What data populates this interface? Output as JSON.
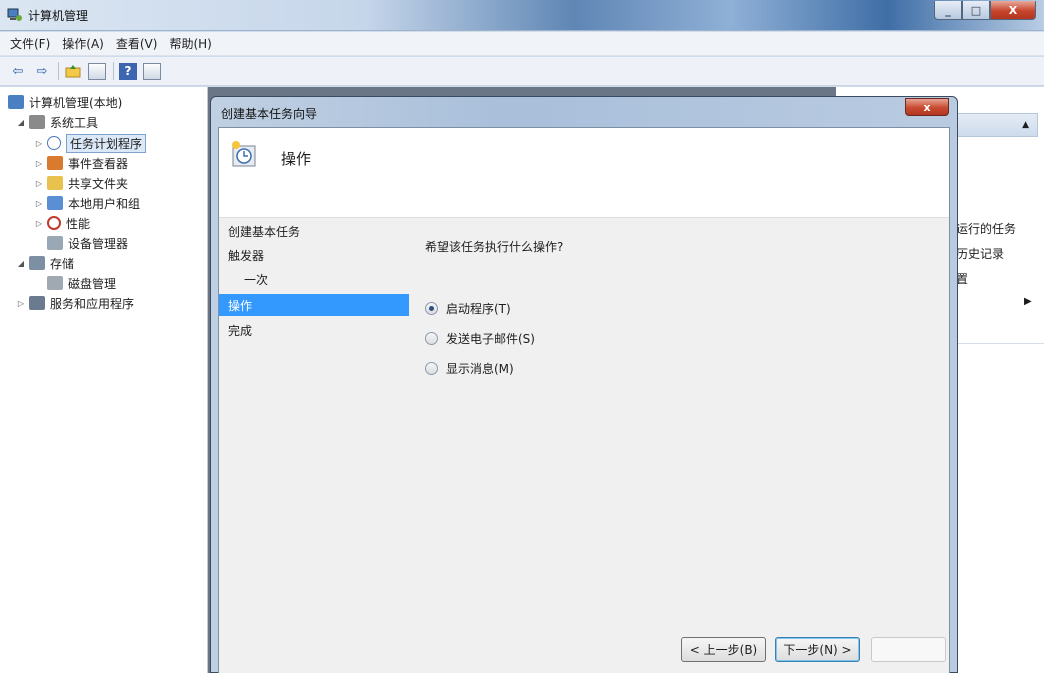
{
  "window": {
    "title": "计算机管理",
    "icon": "computer-management-icon",
    "buttons": {
      "minimize": "_",
      "maximize": "□",
      "close": "X"
    }
  },
  "menu": [
    "文件(F)",
    "操作(A)",
    "查看(V)",
    "帮助(H)"
  ],
  "toolbar": {
    "buttons": [
      "back-arrow-icon",
      "forward-arrow-icon",
      "up-folder-icon",
      "show-hide-tree-icon",
      "help-icon",
      "show-hide-action-pane-icon"
    ],
    "back": "⇦",
    "forward": "⇨",
    "help": "?"
  },
  "tree": {
    "items": [
      {
        "label": "计算机管理(本地)",
        "arrow": "",
        "icon": "computer-icon"
      },
      {
        "label": "系统工具",
        "arrow": "◢",
        "icon": "tools-icon"
      },
      {
        "label": "任务计划程序",
        "arrow": "▷",
        "icon": "clock-icon",
        "selected": true
      },
      {
        "label": "事件查看器",
        "arrow": "▷",
        "icon": "event-viewer-icon"
      },
      {
        "label": "共享文件夹",
        "arrow": "▷",
        "icon": "shared-folder-icon"
      },
      {
        "label": "本地用户和组",
        "arrow": "▷",
        "icon": "users-icon"
      },
      {
        "label": "性能",
        "arrow": "▷",
        "icon": "performance-icon"
      },
      {
        "label": "设备管理器",
        "arrow": "",
        "icon": "device-manager-icon"
      },
      {
        "label": "存储",
        "arrow": "◢",
        "icon": "storage-icon"
      },
      {
        "label": "磁盘管理",
        "arrow": "",
        "icon": "disk-icon"
      },
      {
        "label": "服务和应用程序",
        "arrow": "▷",
        "icon": "services-icon"
      }
    ]
  },
  "actions": {
    "collapse_arrow": "▲",
    "items": [
      "运行的任务",
      "历史记录",
      "置"
    ],
    "submenu_arrow": "▶"
  },
  "dialog": {
    "title": "创建基本任务向导",
    "close": "x",
    "header_title": "操作",
    "header_icon": "scheduled-task-icon",
    "steps": [
      {
        "label": "创建基本任务"
      },
      {
        "label": "触发器"
      },
      {
        "label": "一次",
        "indent": true
      },
      {
        "label": "操作",
        "active": true
      },
      {
        "label": "完成"
      }
    ],
    "prompt": "希望该任务执行什么操作?",
    "options": [
      {
        "label": "启动程序(T)",
        "checked": true
      },
      {
        "label": "发送电子邮件(S)",
        "checked": false
      },
      {
        "label": "显示消息(M)",
        "checked": false
      }
    ],
    "buttons": {
      "back": "< 上一步(B)",
      "next": "下一步(N) >"
    }
  }
}
